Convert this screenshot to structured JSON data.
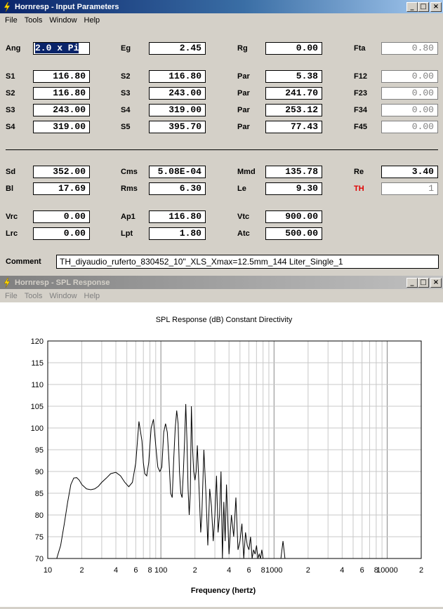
{
  "window1": {
    "title": "Hornresp - Input Parameters",
    "menu": [
      "File",
      "Tools",
      "Window",
      "Help"
    ],
    "fields": [
      {
        "label": "Ang",
        "value": "2.0 x Pi",
        "selected": true
      },
      {
        "label": "Eg",
        "value": "2.45"
      },
      {
        "label": "Rg",
        "value": "0.00"
      },
      {
        "label": "Fta",
        "value": "0.80",
        "gray": true
      },
      {
        "label": "S1",
        "value": "116.80"
      },
      {
        "label": "S2",
        "value": "116.80"
      },
      {
        "label": "Par",
        "value": "5.38"
      },
      {
        "label": "F12",
        "value": "0.00",
        "gray": true
      },
      {
        "label": "S2",
        "value": "116.80"
      },
      {
        "label": "S3",
        "value": "243.00"
      },
      {
        "label": "Par",
        "value": "241.70"
      },
      {
        "label": "F23",
        "value": "0.00",
        "gray": true
      },
      {
        "label": "S3",
        "value": "243.00"
      },
      {
        "label": "S4",
        "value": "319.00"
      },
      {
        "label": "Par",
        "value": "253.12"
      },
      {
        "label": "F34",
        "value": "0.00",
        "gray": true
      },
      {
        "label": "S4",
        "value": "319.00"
      },
      {
        "label": "S5",
        "value": "395.70"
      },
      {
        "label": "Par",
        "value": "77.43"
      },
      {
        "label": "F45",
        "value": "0.00",
        "gray": true
      },
      {
        "label": "Sd",
        "value": "352.00"
      },
      {
        "label": "Cms",
        "value": "5.08E-04"
      },
      {
        "label": "Mmd",
        "value": "135.78"
      },
      {
        "label": "Re",
        "value": "3.40"
      },
      {
        "label": "Bl",
        "value": "17.69"
      },
      {
        "label": "Rms",
        "value": "6.30"
      },
      {
        "label": "Le",
        "value": "9.30"
      },
      {
        "label": "TH",
        "value": "1",
        "gray": true,
        "red": true
      },
      {
        "label": "Vrc",
        "value": "0.00"
      },
      {
        "label": "Ap1",
        "value": "116.80"
      },
      {
        "label": "Vtc",
        "value": "900.00"
      },
      {
        "label": "Lrc",
        "value": "0.00"
      },
      {
        "label": "Lpt",
        "value": "1.80"
      },
      {
        "label": "Atc",
        "value": "500.00"
      }
    ],
    "comment_label": "Comment",
    "comment_value": "TH_diyaudio_ruferto_830452_10\"_XLS_Xmax=12.5mm_144 Liter_Single_1"
  },
  "window2": {
    "title": "Hornresp - SPL Response",
    "menu": [
      "File",
      "Tools",
      "Window",
      "Help"
    ]
  },
  "chart_data": {
    "type": "line",
    "title": "SPL Response (dB)   Constant Directivity",
    "xlabel": "Frequency (hertz)",
    "ylabel": "",
    "xscale": "log",
    "xlim": [
      10,
      20000
    ],
    "ylim": [
      70,
      120
    ],
    "grid": true,
    "yticks": [
      70,
      75,
      80,
      85,
      90,
      95,
      100,
      105,
      110,
      115,
      120
    ],
    "xtick_labels": [
      "10",
      "2",
      "4",
      "6",
      "8",
      "100",
      "2",
      "4",
      "6",
      "8",
      "1000",
      "2",
      "4",
      "6",
      "8",
      "10000",
      "2"
    ],
    "series": [
      {
        "x": [
          12,
          13,
          14,
          15,
          16,
          17,
          18,
          19,
          20,
          22,
          24,
          26,
          28,
          30,
          33,
          36,
          40,
          44,
          48,
          52,
          56,
          60,
          64,
          68,
          70,
          72,
          75,
          78,
          82,
          86,
          90,
          94,
          98,
          102,
          106,
          110,
          114,
          118,
          122,
          126,
          130,
          134,
          138,
          142,
          146,
          150,
          154,
          158,
          162,
          166,
          170,
          174,
          178,
          182,
          186,
          190,
          195,
          200,
          205,
          210,
          215,
          220,
          225,
          230,
          240,
          250,
          260,
          270,
          280,
          290,
          300,
          310,
          320,
          330,
          340,
          350,
          360,
          370,
          380,
          400,
          420,
          440,
          460,
          480,
          500,
          520,
          540,
          560,
          580,
          600,
          620,
          640,
          660,
          680,
          700,
          720,
          740,
          760,
          780,
          800,
          1000,
          1150,
          1200,
          1250,
          1400
        ],
        "values": [
          70,
          73,
          78,
          83,
          87,
          88.5,
          88.6,
          88,
          87,
          86,
          85.8,
          86,
          86.6,
          87.5,
          88.5,
          89.5,
          89.8,
          89,
          87.5,
          86.5,
          87.5,
          92,
          101.5,
          97,
          92,
          89.5,
          89,
          92,
          100,
          102,
          96,
          91,
          90,
          91,
          99,
          101,
          99,
          92.5,
          85,
          84,
          93,
          100,
          104,
          101,
          90,
          85,
          84,
          90,
          97,
          105.5,
          97,
          86,
          80,
          85,
          105,
          96,
          90,
          88,
          90,
          96,
          89.5,
          83,
          76,
          80,
          95,
          85,
          73,
          86,
          82,
          74,
          80,
          89,
          76,
          80,
          90,
          70,
          83,
          74,
          87,
          71,
          80,
          75,
          84,
          72,
          74,
          78,
          70,
          76,
          73,
          72,
          75,
          70,
          72,
          71,
          73,
          70,
          71,
          70,
          72,
          70,
          70,
          70,
          74,
          70,
          70
        ]
      }
    ]
  }
}
